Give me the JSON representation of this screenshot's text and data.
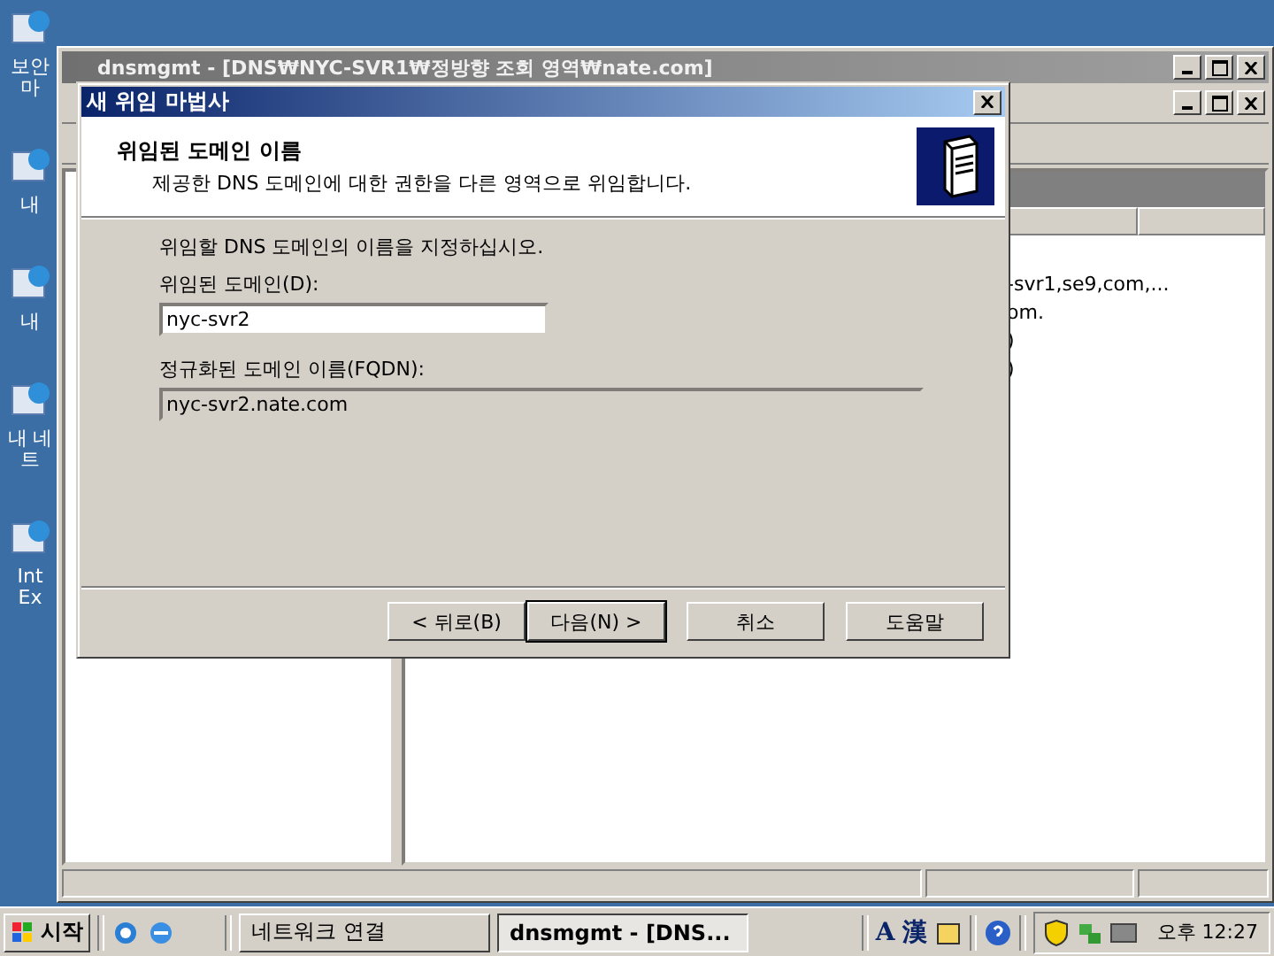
{
  "desktop_icons": [
    {
      "lines": [
        "보안",
        "마"
      ]
    },
    {
      "lines": [
        "내"
      ]
    },
    {
      "lines": [
        "내"
      ]
    },
    {
      "lines": [
        "내 네",
        "트"
      ]
    },
    {
      "lines": [
        "Int",
        "Ex"
      ]
    }
  ],
  "console_window": {
    "title": "dnsmgmt - [DNS₩NYC-SVR1₩정방향 조회 영역₩nate.com]",
    "right_pane_rows": [
      "-svr1,se9,com,...",
      "om.",
      ")",
      ")"
    ]
  },
  "wizard": {
    "title": "새 위임 마법사",
    "heading": "위임된 도메인 이름",
    "subheading": "제공한 DNS 도메인에 대한 권한을 다른 영역으로 위임합니다.",
    "instruction": "위임할 DNS 도메인의 이름을 지정하십시오.",
    "domain_label": "위임된 도메인(D):",
    "domain_value": "nyc-svr2",
    "fqdn_label": "정규화된 도메인 이름(FQDN):",
    "fqdn_value": "nyc-svr2.nate.com",
    "buttons": [
      {
        "label": "< 뒤로(B)",
        "default": false
      },
      {
        "label": "다음(N) >",
        "default": true
      },
      {
        "label": "취소",
        "default": false
      },
      {
        "label": "도움말",
        "default": false
      }
    ]
  },
  "taskbar": {
    "start": "시작",
    "tasks": [
      {
        "label": "네트워크 연결",
        "selected": false
      },
      {
        "label": "dnsmgmt - [DNS...",
        "selected": true
      }
    ],
    "ime": [
      "A",
      "漢"
    ],
    "clock": "오후 12:27"
  }
}
